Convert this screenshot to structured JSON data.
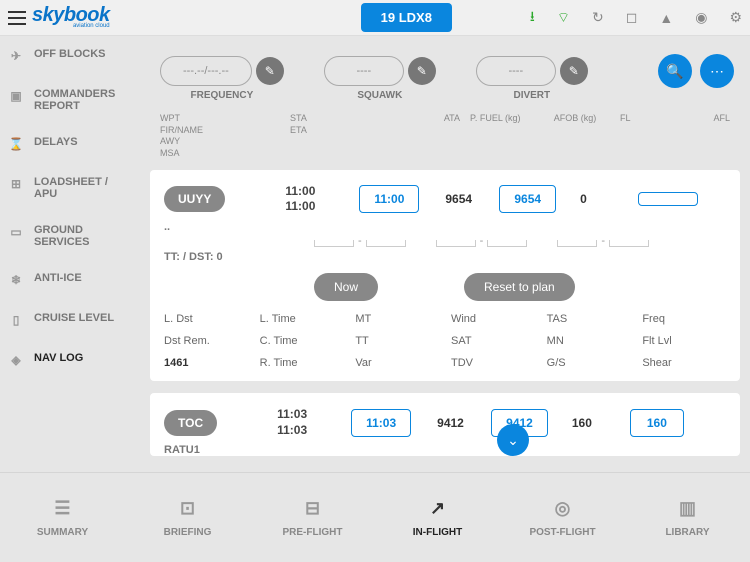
{
  "brand": {
    "name": "skybook",
    "tagline": "aviation cloud"
  },
  "flight_id": "19 LDX8",
  "pills": [
    {
      "value": "---.--/---.--",
      "label": "FREQUENCY"
    },
    {
      "value": "----",
      "label": "SQUAWK"
    },
    {
      "value": "----",
      "label": "DIVERT"
    }
  ],
  "sidebar": [
    {
      "label": "OFF BLOCKS",
      "icon": "plane"
    },
    {
      "label": "COMMANDERS REPORT",
      "icon": "clipboard"
    },
    {
      "label": "DELAYS",
      "icon": "hourglass"
    },
    {
      "label": "LOADSHEET / APU",
      "icon": "cart"
    },
    {
      "label": "GROUND SERVICES",
      "icon": "truck"
    },
    {
      "label": "ANTI-ICE",
      "icon": "snowflake"
    },
    {
      "label": "CRUISE LEVEL",
      "icon": "ruler"
    },
    {
      "label": "NAV LOG",
      "icon": "compass"
    }
  ],
  "col_headers": {
    "c1": "WPT\nFIR/NAME\nAWY\nMSA",
    "c2": "STA\nETA",
    "c3": "ATA",
    "c4": "P. FUEL (kg)",
    "c5": "AFOB (kg)",
    "c6": "FL",
    "c7": "AFL"
  },
  "waypoints": [
    {
      "id": "UUYY",
      "sta": "11:00",
      "eta": "11:00",
      "ata": "11:00",
      "pfuel": "9654",
      "afob": "9654",
      "fl": "0",
      "afl": "",
      "sub": "..",
      "tt_dst": "TT: / DST: 0",
      "btn_now": "Now",
      "btn_reset": "Reset to plan",
      "grid": [
        "L. Dst",
        "L. Time",
        "MT",
        "Wind",
        "TAS",
        "Freq",
        "Dst Rem.",
        "C. Time",
        "TT",
        "SAT",
        "MN",
        "Flt Lvl",
        "1461",
        "R. Time",
        "Var",
        "TDV",
        "G/S",
        "Shear"
      ]
    },
    {
      "id": "TOC",
      "sta": "11:03",
      "eta": "11:03",
      "ata": "11:03",
      "pfuel": "9412",
      "afob": "9412",
      "fl": "160",
      "afl": "160",
      "sub": "RATU1"
    }
  ],
  "bottom_tabs": [
    {
      "label": "SUMMARY"
    },
    {
      "label": "BRIEFING"
    },
    {
      "label": "PRE-FLIGHT"
    },
    {
      "label": "IN-FLIGHT"
    },
    {
      "label": "POST-FLIGHT"
    },
    {
      "label": "LIBRARY"
    }
  ]
}
